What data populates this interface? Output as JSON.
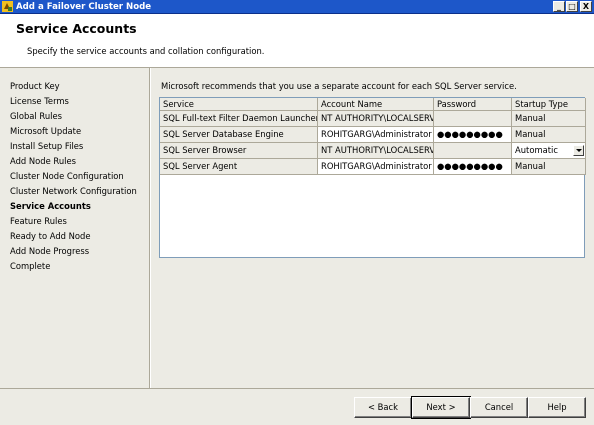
{
  "window": {
    "title": "Add a Failover Cluster Node",
    "controls": {
      "minimize": "_",
      "maximize": "□",
      "close": "X"
    }
  },
  "header": {
    "title": "Service Accounts",
    "subtitle": "Specify the service accounts and collation configuration."
  },
  "sidebar": {
    "items": [
      {
        "label": "Product Key",
        "active": false
      },
      {
        "label": "License Terms",
        "active": false
      },
      {
        "label": "Global Rules",
        "active": false
      },
      {
        "label": "Microsoft Update",
        "active": false
      },
      {
        "label": "Install Setup Files",
        "active": false
      },
      {
        "label": "Add Node Rules",
        "active": false
      },
      {
        "label": "Cluster Node Configuration",
        "active": false
      },
      {
        "label": "Cluster Network Configuration",
        "active": false
      },
      {
        "label": "Service Accounts",
        "active": true
      },
      {
        "label": "Feature Rules",
        "active": false
      },
      {
        "label": "Ready to Add Node",
        "active": false
      },
      {
        "label": "Add Node Progress",
        "active": false
      },
      {
        "label": "Complete",
        "active": false
      }
    ]
  },
  "main": {
    "note": "Microsoft recommends that you use a separate account for each SQL Server service.",
    "table": {
      "headers": [
        "Service",
        "Account Name",
        "Password",
        "Startup Type"
      ],
      "rows": [
        {
          "service": "SQL Full-text Filter Daemon Launcher",
          "account": "NT AUTHORITY\\LOCALSERV...",
          "password": "",
          "startup": "Manual"
        },
        {
          "service": "SQL Server Database Engine",
          "account": "ROHITGARG\\Administrator",
          "password": "●●●●●●●●●",
          "startup": "Manual"
        },
        {
          "service": "SQL Server Browser",
          "account": "NT AUTHORITY\\LOCALSERV...",
          "password": "",
          "startup": "Automatic"
        },
        {
          "service": "SQL Server Agent",
          "account": "ROHITGARG\\Administrator",
          "password": "●●●●●●●●●",
          "startup": "Manual"
        }
      ]
    }
  },
  "footer": {
    "back": "< Back",
    "next": "Next >",
    "cancel": "Cancel",
    "help": "Help"
  },
  "colors": {
    "titlebar": "#1d57c9",
    "panel": "#ecebe4",
    "border": "#aca899"
  }
}
